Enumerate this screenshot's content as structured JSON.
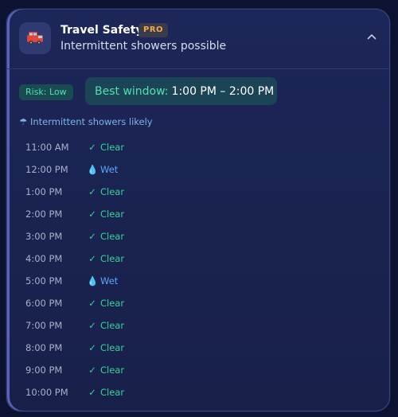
{
  "header": {
    "title": "Travel Safety",
    "badge": "PRO",
    "subtitle": "Intermittent showers possible",
    "icon": "car-icon"
  },
  "summary": {
    "risk": "Risk: Low",
    "best_label": "Best window:",
    "best_time": "1:00 PM – 2:00 PM",
    "note": "Intermittent showers likely",
    "note_icon": "umbrella-icon"
  },
  "hours": [
    {
      "time": "11:00 AM",
      "status": "Clear",
      "kind": "clear"
    },
    {
      "time": "12:00 PM",
      "status": "Wet",
      "kind": "wet"
    },
    {
      "time": "1:00 PM",
      "status": "Clear",
      "kind": "clear"
    },
    {
      "time": "2:00 PM",
      "status": "Clear",
      "kind": "clear"
    },
    {
      "time": "3:00 PM",
      "status": "Clear",
      "kind": "clear"
    },
    {
      "time": "4:00 PM",
      "status": "Clear",
      "kind": "clear"
    },
    {
      "time": "5:00 PM",
      "status": "Wet",
      "kind": "wet"
    },
    {
      "time": "6:00 PM",
      "status": "Clear",
      "kind": "clear"
    },
    {
      "time": "7:00 PM",
      "status": "Clear",
      "kind": "clear"
    },
    {
      "time": "8:00 PM",
      "status": "Clear",
      "kind": "clear"
    },
    {
      "time": "9:00 PM",
      "status": "Clear",
      "kind": "clear"
    },
    {
      "time": "10:00 PM",
      "status": "Clear",
      "kind": "clear"
    }
  ],
  "colors": {
    "clear": "#34d399",
    "wet": "#60a5fa",
    "accent": "#4ee0b0",
    "badge": "#f0a84a"
  }
}
